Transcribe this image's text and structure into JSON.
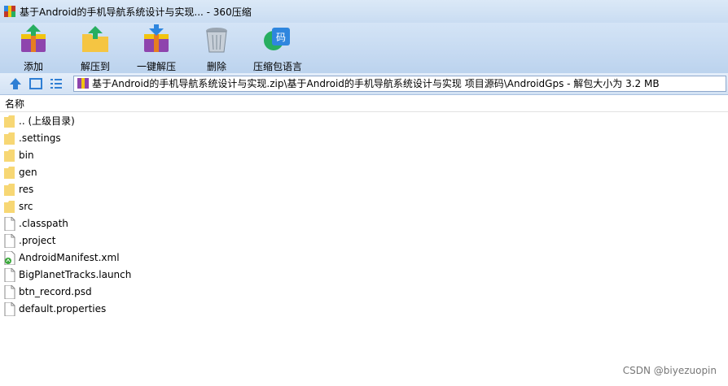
{
  "window": {
    "title": "基于Android的手机导航系统设计与实现... - 360压缩"
  },
  "toolbar": {
    "add_label": "添加",
    "extract_to_label": "解压到",
    "one_click_extract_label": "一键解压",
    "delete_label": "删除",
    "encoding_label": "压缩包语言"
  },
  "address": {
    "path": "基于Android的手机导航系统设计与实现.zip\\基于Android的手机导航系统设计与实现 项目源码\\AndroidGps - 解包大小为 3.2 MB"
  },
  "list": {
    "column_name": "名称",
    "items": [
      {
        "name": ".. (上级目录)",
        "type": "folder"
      },
      {
        "name": ".settings",
        "type": "folder"
      },
      {
        "name": "bin",
        "type": "folder"
      },
      {
        "name": "gen",
        "type": "folder"
      },
      {
        "name": "res",
        "type": "folder"
      },
      {
        "name": "src",
        "type": "folder"
      },
      {
        "name": ".classpath",
        "type": "file"
      },
      {
        "name": ".project",
        "type": "file"
      },
      {
        "name": "AndroidManifest.xml",
        "type": "xml"
      },
      {
        "name": "BigPlanetTracks.launch",
        "type": "file"
      },
      {
        "name": "btn_record.psd",
        "type": "file"
      },
      {
        "name": "default.properties",
        "type": "file"
      }
    ]
  },
  "watermark": "CSDN @biyezuopin",
  "colors": {
    "folder": "#f7d774",
    "toolbar": "#c9dcf2",
    "accent": "#2f6fc4"
  }
}
